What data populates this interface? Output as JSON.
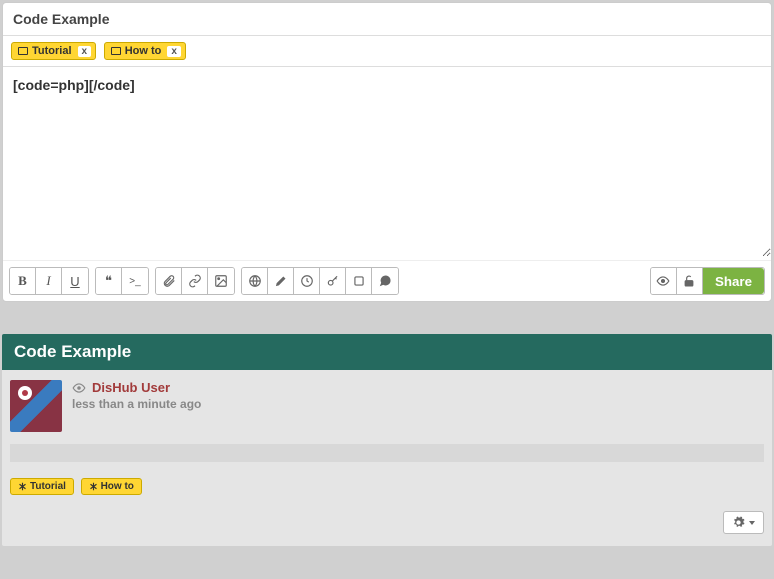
{
  "editor": {
    "title": "Code Example",
    "tags": [
      {
        "label": "Tutorial",
        "close": "x"
      },
      {
        "label": "How to",
        "close": "x"
      }
    ],
    "content": "[code=php][/code]",
    "share_label": "Share"
  },
  "toolbar": {
    "bold": "B",
    "italic": "I",
    "underline": "U",
    "quote_glyph": "❝",
    "code_glyph": ">_"
  },
  "post": {
    "title": "Code Example",
    "author": "DisHub User",
    "time": "less than a minute ago",
    "tags": [
      {
        "label": "Tutorial"
      },
      {
        "label": "How to"
      }
    ]
  }
}
